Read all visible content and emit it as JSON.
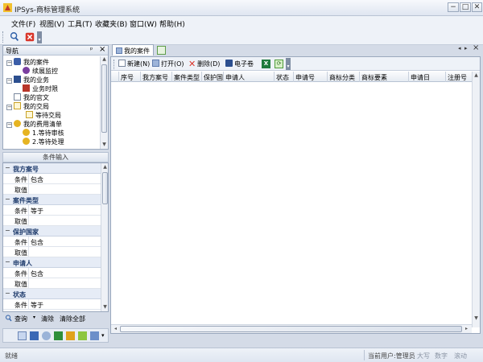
{
  "window": {
    "title": "IPSys-商标管理系统",
    "controls": {
      "minimize": "−",
      "maximize": "□",
      "close": "✕"
    }
  },
  "menu": [
    "文件(F)",
    "视图(V)",
    "工具(T)",
    "收藏夹(B)",
    "窗口(W)",
    "帮助(H)"
  ],
  "toolbar": {
    "icons": [
      "search-icon",
      "close-icon"
    ]
  },
  "nav": {
    "title": "导航",
    "pin": "ᵖ",
    "close": "×",
    "items": [
      {
        "label": "我的案件",
        "level": 0,
        "expand": "−",
        "icon": "folder-eye"
      },
      {
        "label": "续展监控",
        "level": 1,
        "icon": "eye"
      },
      {
        "label": "我的业务",
        "level": 0,
        "expand": "−",
        "icon": "book"
      },
      {
        "label": "业务时限",
        "level": 1,
        "icon": "calendar"
      },
      {
        "label": "我的官文",
        "level": 0,
        "icon": "doc"
      },
      {
        "label": "我的交局",
        "level": 0,
        "expand": "−",
        "icon": "doc"
      },
      {
        "label": "等待交局",
        "level": 1,
        "icon": "doc"
      },
      {
        "label": "我的费用清单",
        "level": 0,
        "expand": "−",
        "icon": "coins"
      },
      {
        "label": "1.等待审核",
        "level": 1,
        "icon": "coins"
      },
      {
        "label": "2.等待处理",
        "level": 1,
        "icon": "coins"
      }
    ]
  },
  "conditions": {
    "title": "条件输入",
    "groups": [
      {
        "name": "我方案号",
        "cond_label": "条件",
        "cond_value": "包含",
        "value_label": "取值"
      },
      {
        "name": "案件类型",
        "cond_label": "条件",
        "cond_value": "等于",
        "value_label": "取值"
      },
      {
        "name": "保护国家",
        "cond_label": "条件",
        "cond_value": "包含",
        "value_label": "取值"
      },
      {
        "name": "申请人",
        "cond_label": "条件",
        "cond_value": "包含",
        "value_label": "取值"
      },
      {
        "name": "状态",
        "cond_label": "条件",
        "cond_value": "等于",
        "value_label": ""
      }
    ],
    "query_label": "查询",
    "clear_label": "清除",
    "clear_all_label": "清除全部"
  },
  "tabs": [
    {
      "label": "我的案件"
    }
  ],
  "grid": {
    "toolbar": {
      "new_label": "新建(N)",
      "open_label": "打开(O)",
      "delete_label": "删除(D)",
      "ebook_label": "电子卷"
    },
    "columns": [
      "序号",
      "我方案号",
      "案件类型",
      "保护国",
      "申请人",
      "状态",
      "申请号",
      "商标分类",
      "商标要素",
      "申请日",
      "注册号"
    ]
  },
  "status": {
    "ready": "就绪",
    "user": "当前用户:管理员",
    "caps": "大写",
    "num": "数字",
    "scroll": "滚动"
  },
  "colors": {
    "accent": "#1d3a6b",
    "border": "#9aa8bd",
    "background": "#d4dbe7"
  }
}
